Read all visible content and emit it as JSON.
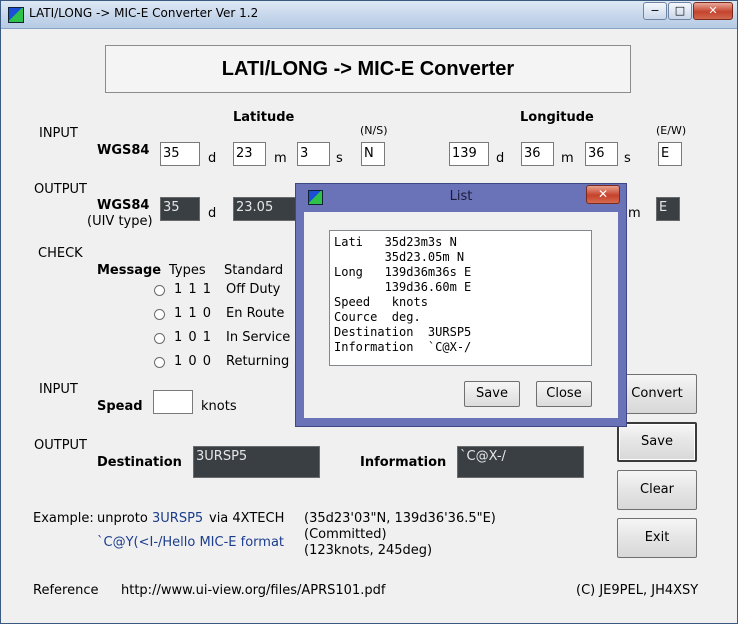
{
  "window": {
    "title": "LATI/LONG -> MIC-E Converter Ver 1.2",
    "minimize": "−",
    "maximize": "□",
    "close": "✕"
  },
  "banner": "LATI/LONG -> MIC-E Converter",
  "input_section": {
    "label": "INPUT",
    "datum": "WGS84",
    "latitude_header": "Latitude",
    "longitude_header": "Longitude",
    "ns_header": "(N/S)",
    "ew_header": "(E/W)",
    "lat_deg": "35",
    "lat_min": "23",
    "lat_sec": "3",
    "lat_dir": "N",
    "lon_deg": "139",
    "lon_min": "36",
    "lon_sec": "36",
    "lon_dir": "E",
    "unit_d": "d",
    "unit_m": "m",
    "unit_s": "s"
  },
  "output_section": {
    "label": "OUTPUT",
    "datum": "WGS84",
    "datum_sub": "(UIV type)",
    "lat_deg": "35",
    "lat_min": "23.05",
    "lon_dir": "E",
    "unit_d": "d",
    "unit_m": "m"
  },
  "check_section": {
    "label": "CHECK",
    "message_header": "Message",
    "types_header": "Types",
    "standard_header": "Standard",
    "options": [
      {
        "code": "1 1 1",
        "name": "Off Duty"
      },
      {
        "code": "1 1 0",
        "name": "En Route"
      },
      {
        "code": "1 0 1",
        "name": "In Service"
      },
      {
        "code": "1 0 0",
        "name": "Returning"
      }
    ]
  },
  "speed_section": {
    "label": "INPUT",
    "speed_label": "Spead",
    "speed_value": "",
    "unit": "knots"
  },
  "dest_section": {
    "label": "OUTPUT",
    "destination_label": "Destination",
    "destination_value": "3URSP5",
    "information_label": "Information",
    "information_value": "`C@X-/"
  },
  "buttons": {
    "convert": "Convert",
    "save": "Save",
    "clear": "Clear",
    "exit": "Exit"
  },
  "example": {
    "label": "Example:",
    "unproto": "unproto",
    "dest": "3URSP5",
    "via": "via 4XTECH",
    "coords": "(35d23'03\"N, 139d36'36.5\"E)",
    "info": "`C@Y(<I-/Hello MIC-E format",
    "status": "(Committed)",
    "speed": "(123knots, 245deg)"
  },
  "footer": {
    "reference_label": "Reference",
    "url": "http://www.ui-view.org/files/APRS101.pdf",
    "credit": "(C) JE9PEL, JH4XSY"
  },
  "dialog": {
    "title": "List",
    "close": "✕",
    "lines": [
      "Lati   35d23m3s N",
      "       35d23.05m N",
      "Long   139d36m36s E",
      "       139d36.60m E",
      "Speed   knots",
      "Cource  deg.",
      "Destination  3URSP5",
      "Information  `C@X-/"
    ],
    "save": "Save",
    "close_button": "Close"
  }
}
